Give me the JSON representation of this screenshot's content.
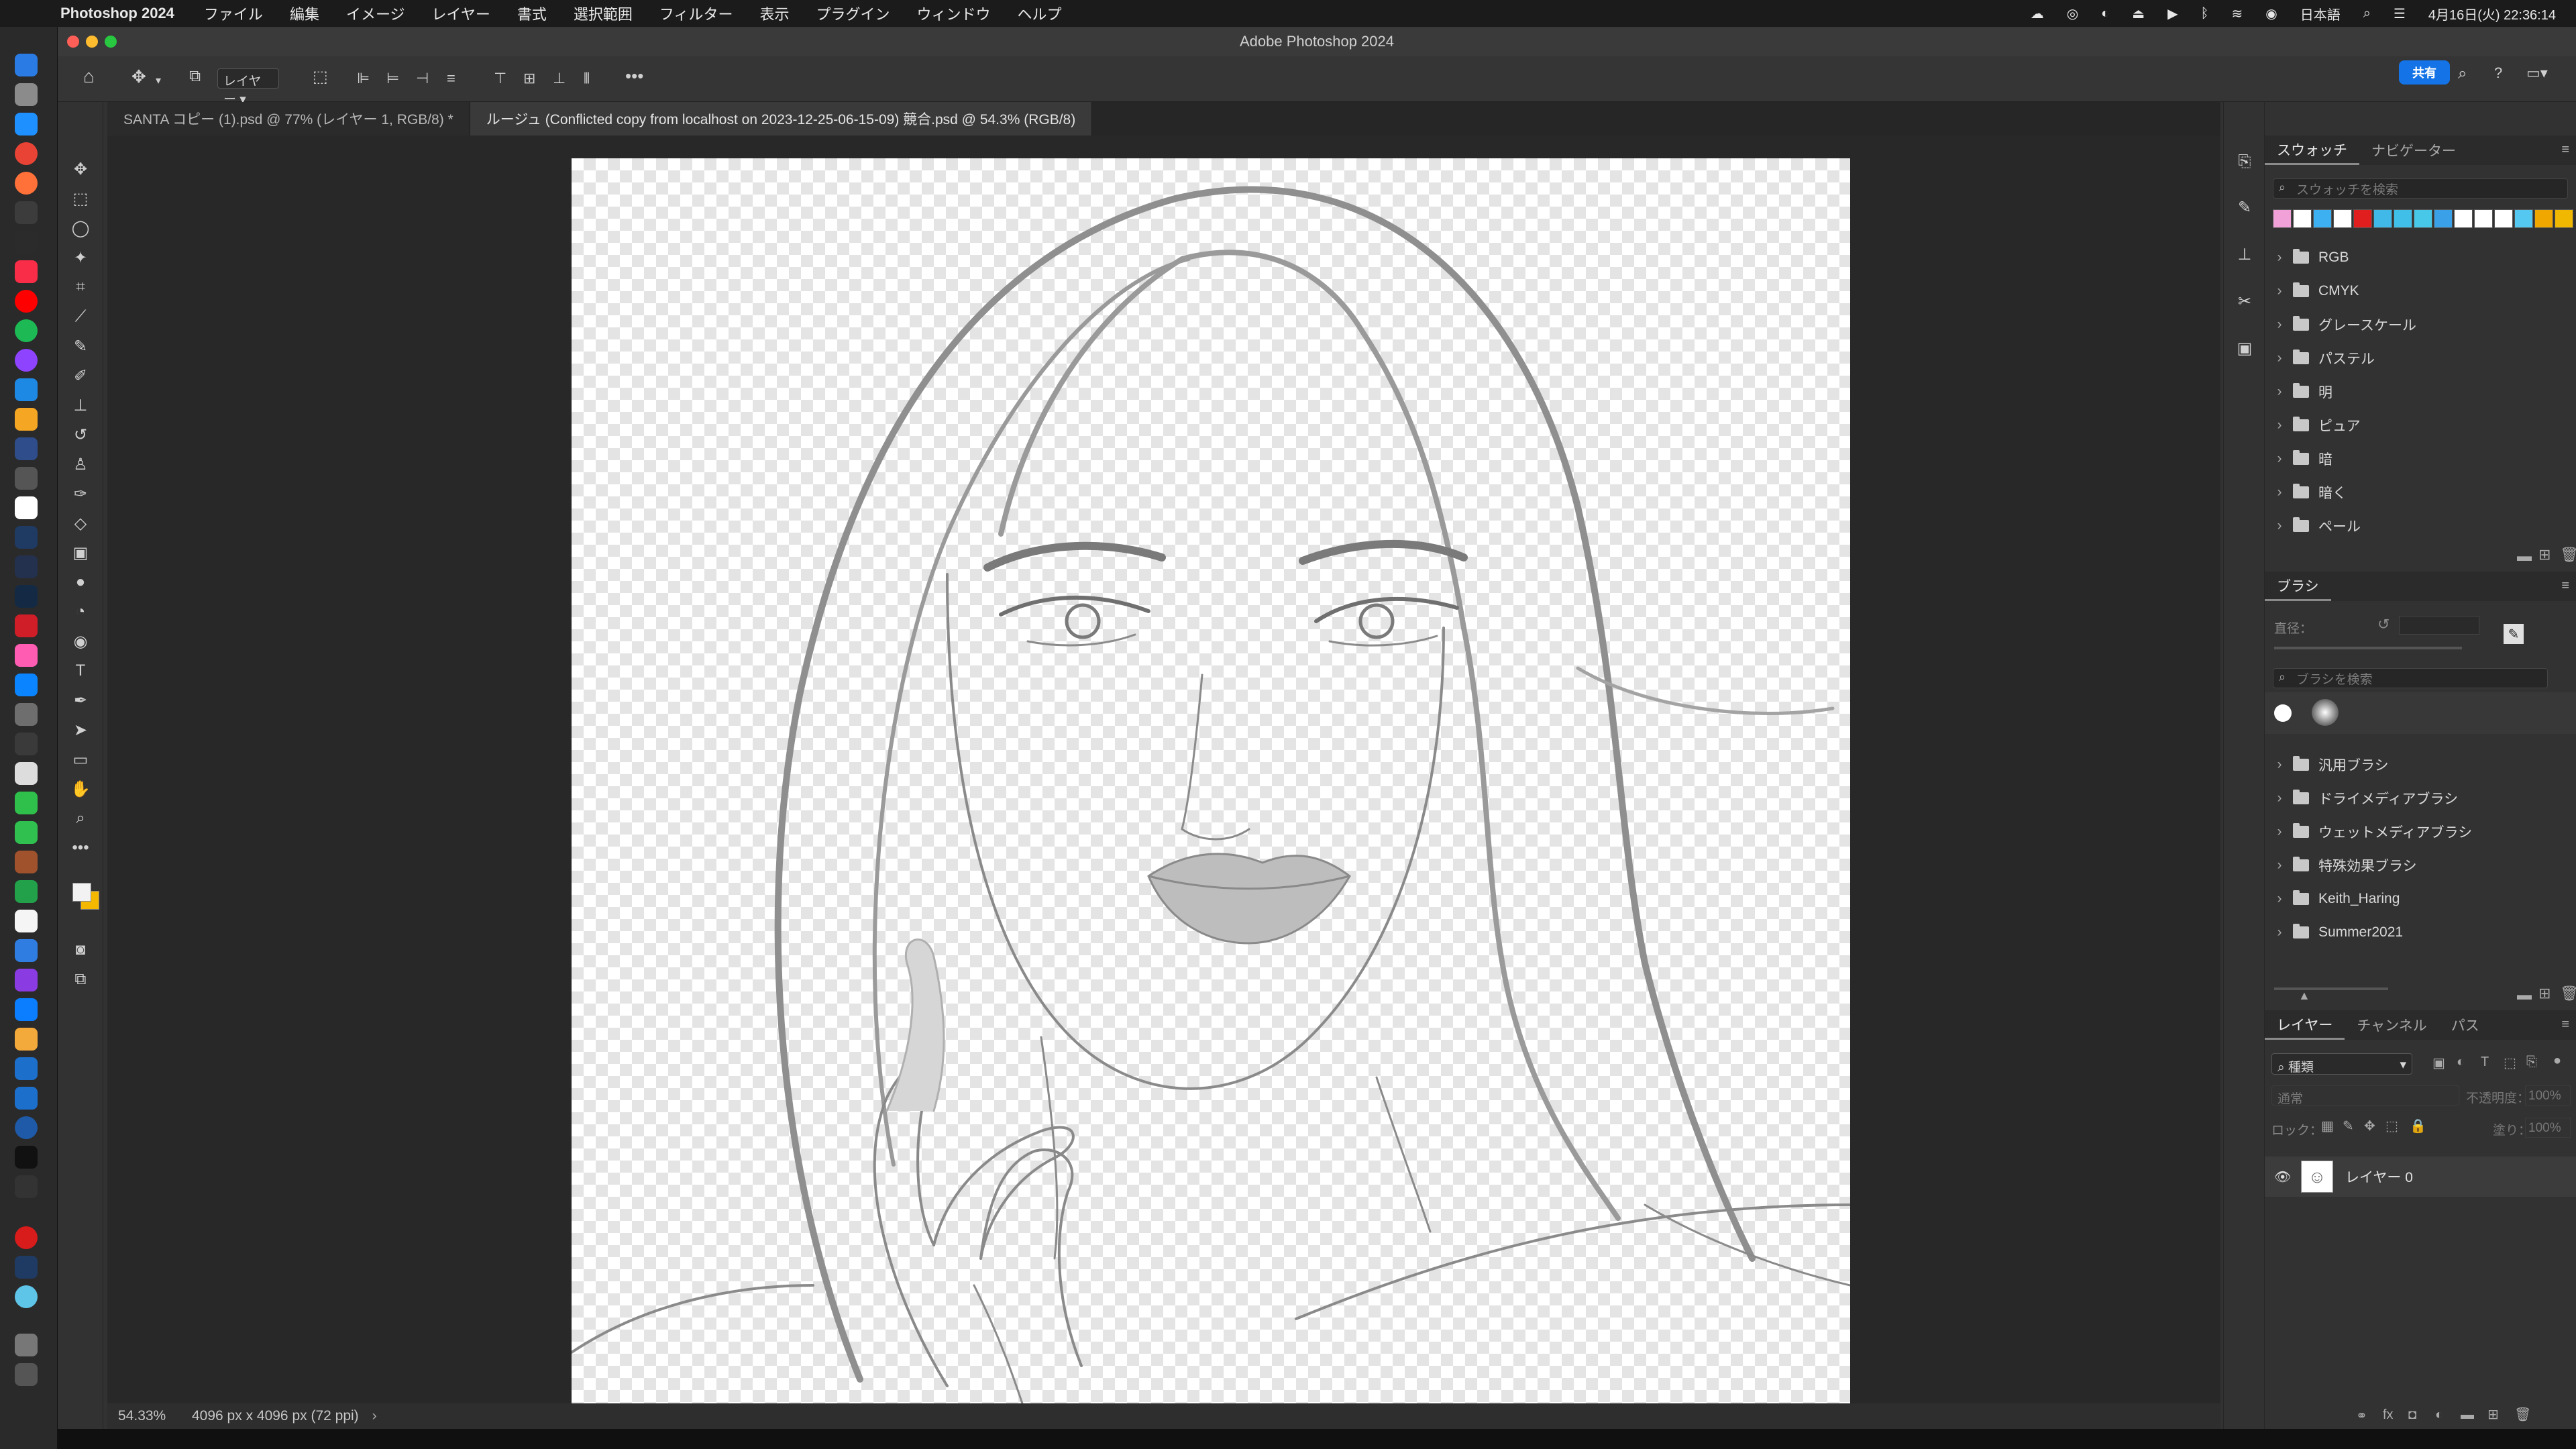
{
  "menubar": {
    "app_name": "Photoshop 2024",
    "items": [
      "ファイル",
      "編集",
      "イメージ",
      "レイヤー",
      "書式",
      "選択範囲",
      "フィルター",
      "表示",
      "プラグイン",
      "ウィンドウ",
      "ヘルプ"
    ],
    "input_method": "日本語",
    "datetime": "4月16日(火) 22:36:14"
  },
  "window": {
    "title": "Adobe Photoshop 2024"
  },
  "options": {
    "layer_select": "レイヤー",
    "share_label": "共有"
  },
  "tabs": [
    {
      "label": "SANTA コピー (1).psd @ 77% (レイヤー 1, RGB/8) *"
    },
    {
      "label": "ルージュ (Conflicted copy from localhost on 2023-12-25-06-15-09) 競合.psd @ 54.3% (RGB/8)"
    }
  ],
  "status": {
    "zoom": "54.33%",
    "doc_size": "4096 px x 4096 px (72 ppi)"
  },
  "swatches_panel": {
    "tabs": [
      "スウォッチ",
      "ナビゲーター"
    ],
    "search_placeholder": "スウォッチを検索",
    "colors": [
      "#f2a0d8",
      "#ffffff",
      "#3cb0f0",
      "#ffffff",
      "#e01e1e",
      "#40b8e8",
      "#40c0e8",
      "#48c8e8",
      "#3aa0e8",
      "#ffffff",
      "#ffffff",
      "#ffffff",
      "#54c8f0",
      "#f0a800",
      "#f0b800"
    ],
    "groups": [
      "RGB",
      "CMYK",
      "グレースケール",
      "パステル",
      "明",
      "ピュア",
      "暗",
      "暗く",
      "ペール"
    ]
  },
  "brush_panel": {
    "tab": "ブラシ",
    "size_label": "直径：",
    "search_placeholder": "ブラシを検索",
    "groups": [
      "汎用ブラシ",
      "ドライメディアブラシ",
      "ウェットメディアブラシ",
      "特殊効果ブラシ",
      "Keith_Haring",
      "Summer2021"
    ]
  },
  "layers_panel": {
    "tabs": [
      "レイヤー",
      "チャンネル",
      "パス"
    ],
    "filter_kind": "種類",
    "blend_mode": "通常",
    "opacity_label": "不透明度：",
    "opacity_value": "100%",
    "lock_label": "ロック：",
    "fill_label": "塗り：",
    "fill_value": "100%",
    "layers": [
      {
        "name": "レイヤー 0"
      }
    ]
  }
}
